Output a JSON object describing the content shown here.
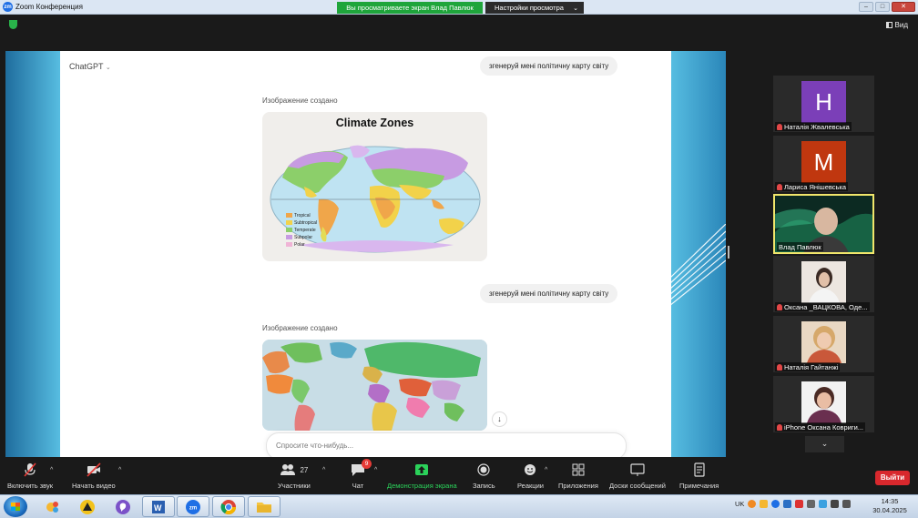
{
  "window": {
    "title": "Zoom Конференция",
    "logo": "zm",
    "share_banner": "Вы просматриваете экран Влад Павлюк",
    "view_settings": "Настройки просмотра"
  },
  "top_right": {
    "view_label": "Вид"
  },
  "shared_screen": {
    "app_name": "ChatGPT",
    "messages": [
      {
        "user_text": "згенеруй мені політичну карту світу",
        "assistant_text": "Изображение создано",
        "image_title": "Climate Zones",
        "legend": [
          "Tropical",
          "Subtropical",
          "Temperate",
          "Subpolar",
          "Polar"
        ]
      },
      {
        "user_text": "згенеруй мені політичну карту світу",
        "assistant_text": "Изображение создано"
      }
    ],
    "composer_placeholder": "Спросите что-нибудь..."
  },
  "participants": [
    {
      "name": "Наталія Жвалевська",
      "initial": "H",
      "color": "#7b3fb8"
    },
    {
      "name": "Лариса Янішевська",
      "initial": "M",
      "color": "#c0370f"
    },
    {
      "name": "Влад Павлюк",
      "active": true
    },
    {
      "name": "Оксана _ВАЦКОВА, Оде..."
    },
    {
      "name": "Наталія Гайтанжі"
    },
    {
      "name": "iPhone Оксана Ковриги..."
    }
  ],
  "toolbar": {
    "mute": "Включить звук",
    "video": "Начать видео",
    "participants": "Участники",
    "participants_count": "27",
    "chat": "Чат",
    "chat_badge": "9",
    "share": "Демонстрация экрана",
    "record": "Запись",
    "reactions": "Реакции",
    "apps": "Приложения",
    "whiteboards": "Доски сообщений",
    "notes": "Примечания",
    "leave": "Выйти"
  },
  "taskbar": {
    "language": "UK",
    "time": "14:35",
    "date": "30.04.2025",
    "zoom_label": "zm"
  }
}
